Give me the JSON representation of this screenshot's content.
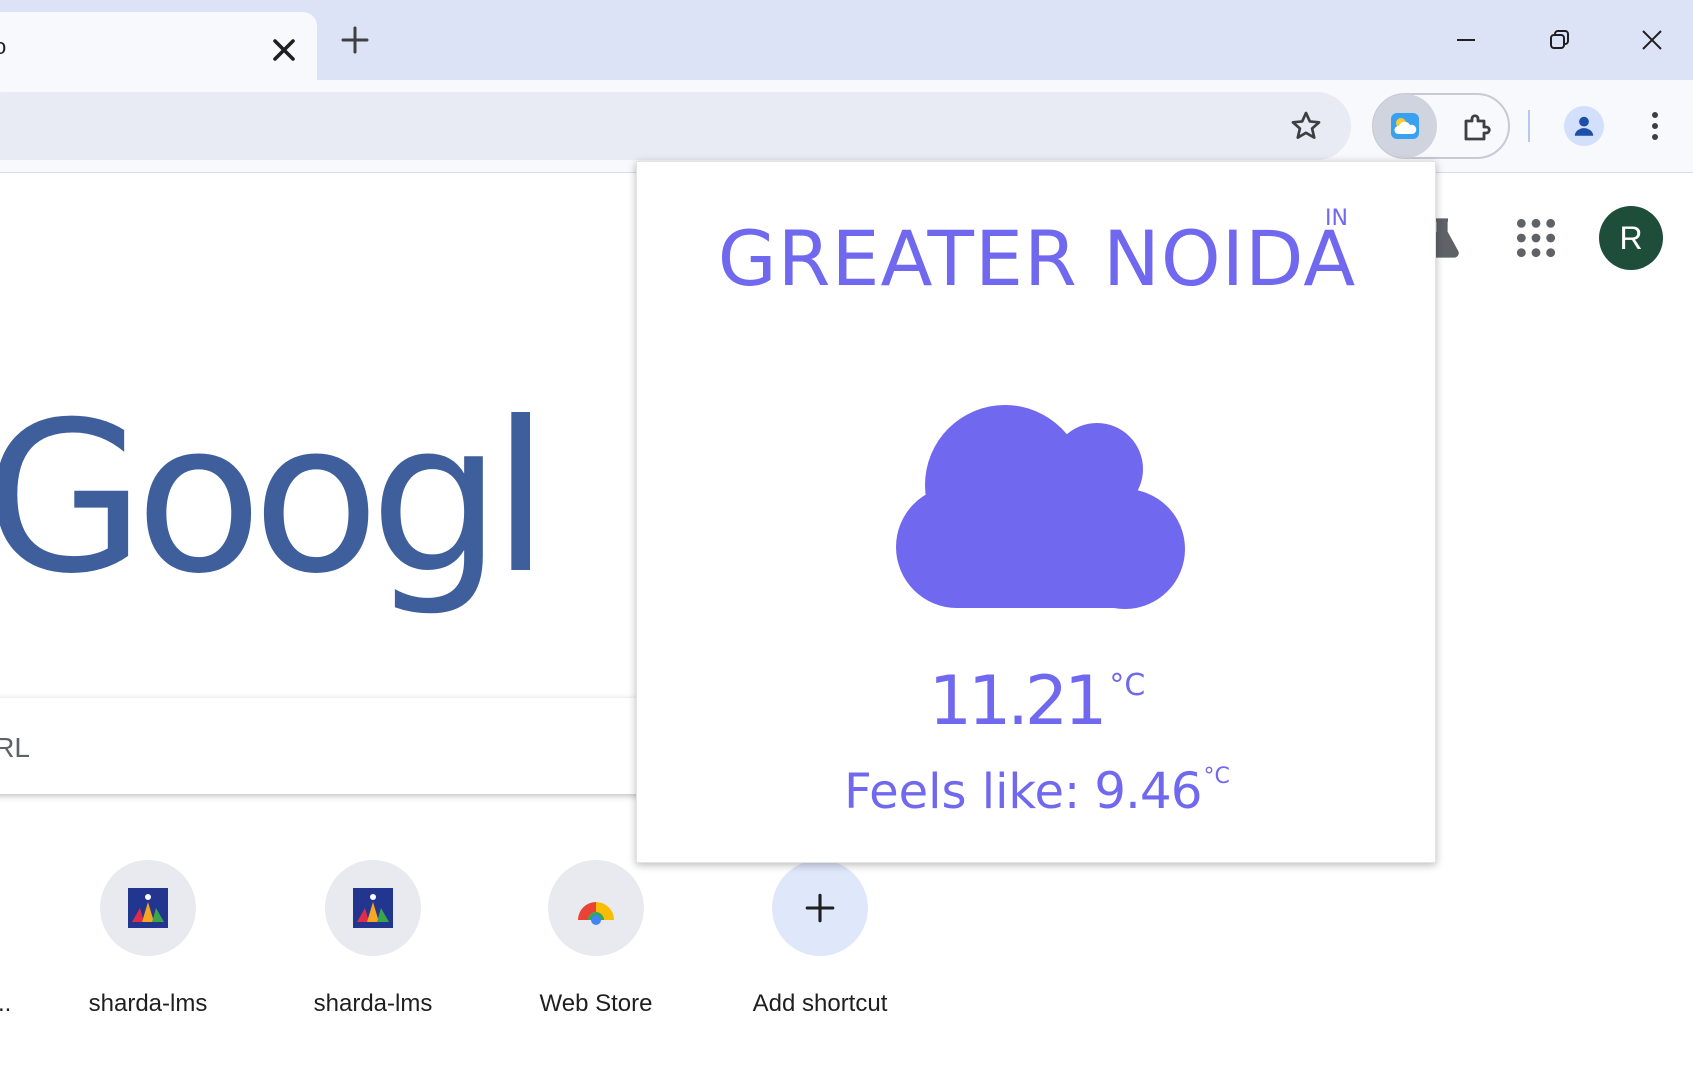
{
  "tab": {
    "title": "o",
    "close_icon": "close-icon"
  },
  "window": {
    "new_tab_icon": "plus-icon",
    "minimize_icon": "minimize-icon",
    "restore_icon": "restore-icon",
    "close_icon": "close-icon"
  },
  "toolbar": {
    "bookmark_icon": "star-icon",
    "weather_extension_icon": "weather-icon",
    "extensions_icon": "puzzle-icon",
    "profile_icon": "person-icon",
    "menu_icon": "kebab-icon"
  },
  "ntp": {
    "labs_icon": "flask-icon",
    "apps_icon": "grid-icon",
    "avatar_letter": "R",
    "logo_text": "Google",
    "search_placeholder_fragment": "RL",
    "cut_label": "..",
    "shortcuts": [
      {
        "label": "sharda-lms",
        "icon": "sharda-logo-icon"
      },
      {
        "label": "sharda-lms",
        "icon": "sharda-logo-icon"
      },
      {
        "label": "Web Store",
        "icon": "webstore-icon"
      },
      {
        "label": "Add shortcut",
        "icon": "plus-icon"
      }
    ]
  },
  "weather": {
    "city": "GREATER NOIDA",
    "country": "IN",
    "condition_icon": "cloud-icon",
    "temperature": "11.21",
    "temperature_unit": "°C",
    "feels_like_label": "Feels like:",
    "feels_like_value": "9.46",
    "feels_like_unit": "°C",
    "accent_color": "#7068ee"
  }
}
